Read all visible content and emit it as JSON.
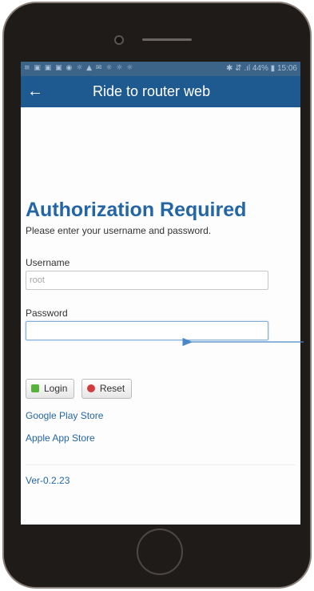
{
  "statusbar": {
    "left_icons": "≡ ▣ ▣ ▣ ◉ ☼ ▲ ✉ ☼ ☼ ☼",
    "right_text": "✱ ⇵ .ıl 44% ▮ 15:06"
  },
  "appbar": {
    "back_icon": "←",
    "title": "Ride to router web"
  },
  "auth": {
    "heading": "Authorization Required",
    "subtitle": "Please enter your username and password.",
    "username_label": "Username",
    "username_value": "root",
    "password_label": "Password",
    "password_value": ""
  },
  "buttons": {
    "login": "Login",
    "reset": "Reset"
  },
  "links": {
    "google": "Google Play Store",
    "apple": "Apple App Store"
  },
  "version": "Ver-0.2.23",
  "colors": {
    "appbar": "#1e5a8f",
    "statusbar": "#3c6388",
    "heading": "#2466a5",
    "arrow": "#4a88c8"
  }
}
